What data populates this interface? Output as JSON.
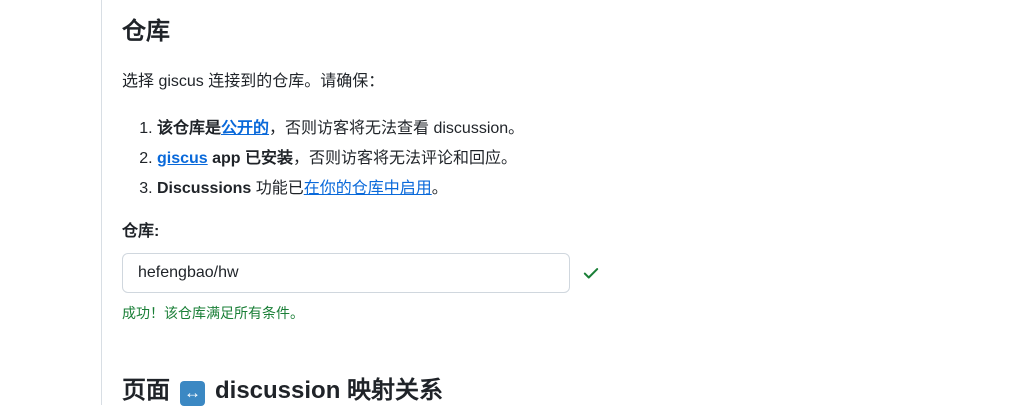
{
  "repo_section": {
    "title": "仓库",
    "intro": "选择 giscus 连接到的仓库。请确保：",
    "requirements": [
      {
        "number": "1.",
        "bold": "该仓库是",
        "link": "公开的",
        "rest": "，否则访客将无法查看 discussion。"
      },
      {
        "number": "2.",
        "link": "giscus",
        "bold": " app 已安装",
        "rest": "，否则访客将无法评论和回应。"
      },
      {
        "number": "3.",
        "bold": "Discussions",
        "rest": " 功能已",
        "link": "在你的仓库中启用",
        "rest2": "。"
      }
    ],
    "field_label": "仓库:",
    "input_value": "hefengbao/hw",
    "success_message": "成功！该仓库满足所有条件。"
  },
  "mapping_section": {
    "title_left": "页面",
    "emoji": "↔",
    "title_right": "discussion 映射关系"
  },
  "colors": {
    "link": "#0969da",
    "success": "#1a7f37",
    "emoji_bg": "#3b88c3"
  },
  "icons": {
    "validation": "check-icon"
  }
}
